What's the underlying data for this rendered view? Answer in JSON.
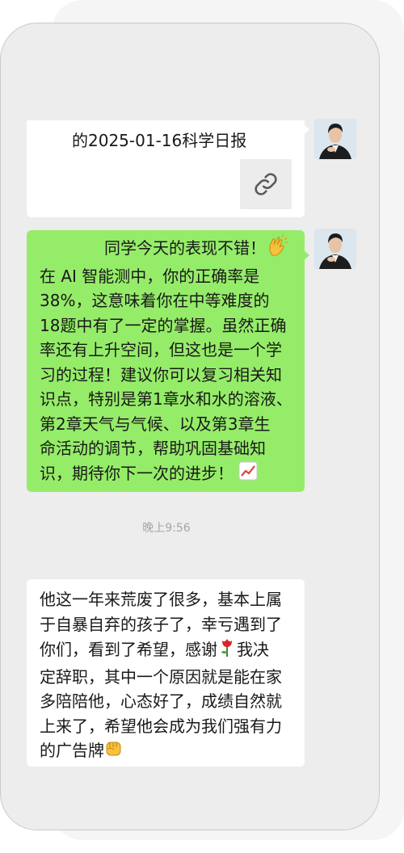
{
  "messages": {
    "link_card": {
      "title": "的2025-01-16科学日报",
      "icon": "link-icon"
    },
    "green_message": {
      "lines": [
        "同学今天的表现不错！",
        "在 AI 智能测中，你的正确率是",
        "38%，这意味着你在中等难度的",
        "18题中有了一定的掌握。虽然正确",
        "率还有上升空间，但这也是一个学",
        "习的过程！建议你可以复习相关知",
        "识点，特别是第1章水和水的溶液、",
        "第2章天气与气候、以及第3章生",
        "命活动的调节，帮助巩固基础知",
        "识，期待你下一次的进步！"
      ],
      "emoji_start": "clapping-hands-emoji",
      "emoji_end": "chart-increasing-emoji"
    },
    "timestamp": "晚上9:56",
    "white_message": {
      "lines": [
        "他这一年来荒废了很多，基本上属",
        "于自暴自弃的孩子了，幸亏遇到了",
        "你们，看到了希望，感谢",
        "我决",
        "定辞职，其中一个原因就是能在家",
        "多陪陪他，心态好了，成绩自然就",
        "上来了，希望他会成为我们强有力",
        "的广告牌"
      ],
      "emoji_rose": "rose-emoji",
      "emoji_fist": "raised-fist-emoji"
    }
  },
  "avatars": [
    "avatar-teacher",
    "avatar-teacher"
  ],
  "colors": {
    "chat_background": "#ededed",
    "sent_bubble": "#95ec69",
    "received_bubble": "#ffffff",
    "timestamp_text": "#a6a6a6"
  }
}
